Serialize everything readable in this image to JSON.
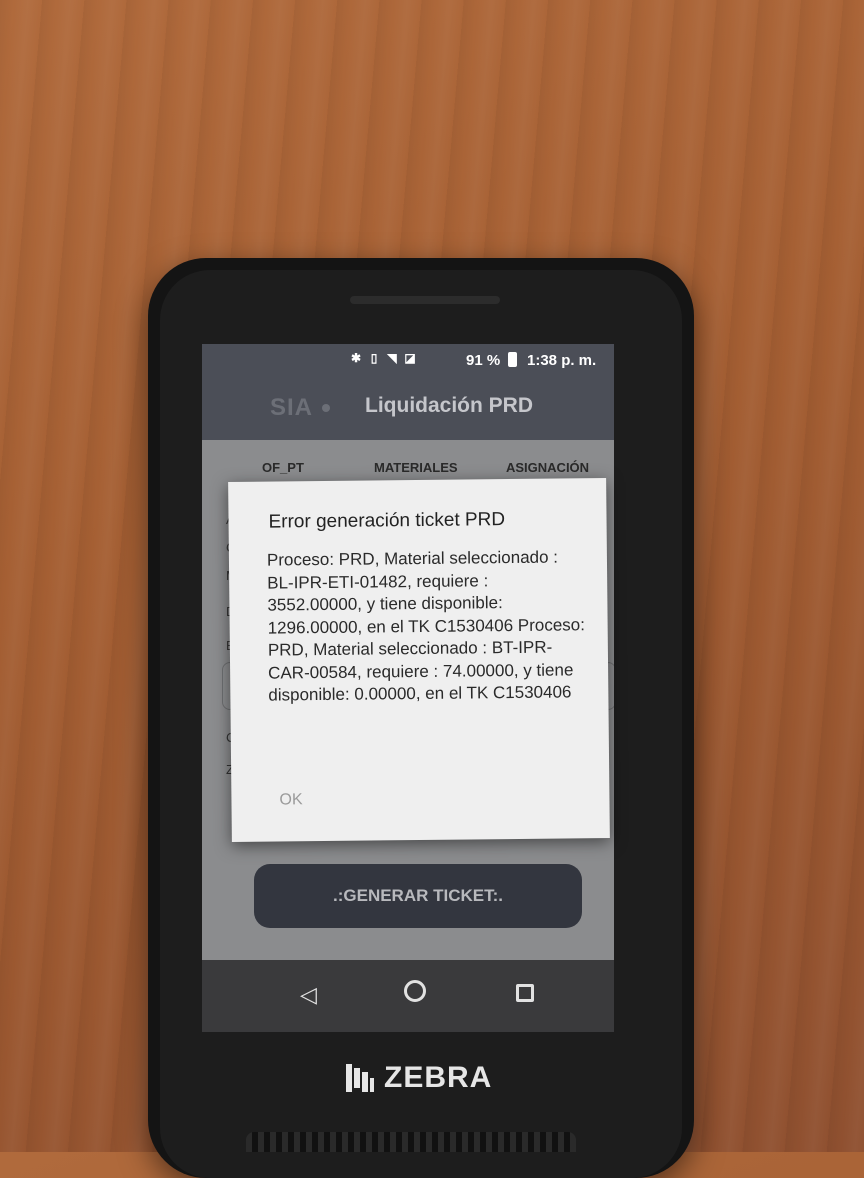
{
  "status_bar": {
    "battery": "91 %",
    "time": "1:38 p. m.",
    "icons": [
      "bluetooth-icon",
      "vibrate-icon",
      "wifi-icon",
      "no-sim-icon",
      "battery-icon"
    ]
  },
  "app_bar": {
    "logo": "SIA",
    "title": "Liquidación PRD"
  },
  "tabs": [
    {
      "label": "OF_PT"
    },
    {
      "label": "MATERIALES"
    },
    {
      "label": "ASIGNACIÓN"
    }
  ],
  "background_labels": [
    "A",
    "C",
    "M",
    "D",
    "E",
    "C",
    "Z"
  ],
  "action_button": {
    "label": ".:GENERAR TICKET:."
  },
  "dialog": {
    "title": "Error generación ticket PRD",
    "message": "Proceso: PRD, Material seleccionado : BL-IPR-ETI-01482, requiere : 3552.00000, y tiene disponible: 1296.00000, en el TK C1530406 Proceso: PRD, Material seleccionado : BT-IPR-CAR-00584, requiere : 74.00000, y tiene disponible: 0.00000, en el TK C1530406",
    "ok_label": "OK"
  },
  "nav_bar": {
    "icons": [
      "back-icon",
      "home-icon",
      "recents-icon"
    ]
  },
  "device_brand": "ZEBRA"
}
